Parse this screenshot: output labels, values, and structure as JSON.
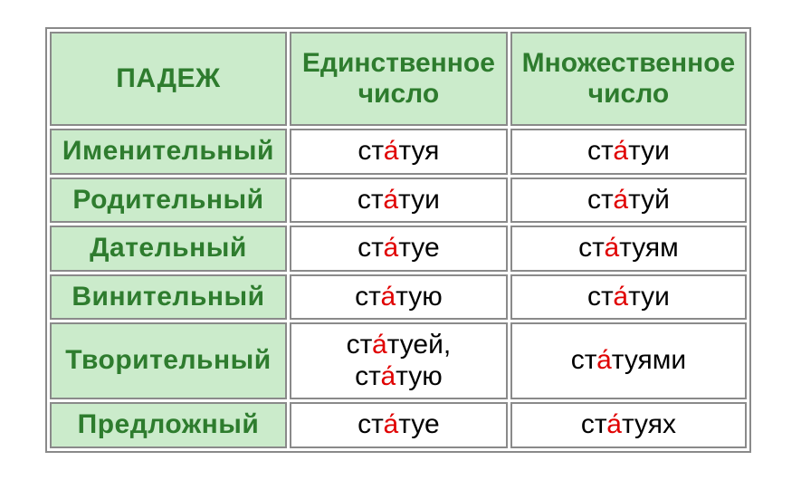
{
  "headers": {
    "case": "ПАДЕЖ",
    "singular_l1": "Единственное",
    "singular_l2": "число",
    "plural_l1": "Множественное",
    "plural_l2": "число"
  },
  "rows": [
    {
      "case": "Именительный",
      "sg": {
        "pre": "ст",
        "accent": "а́",
        "post": "туя"
      },
      "pl": {
        "pre": "ст",
        "accent": "а́",
        "post": "туи"
      }
    },
    {
      "case": "Родительный",
      "sg": {
        "pre": "ст",
        "accent": "а́",
        "post": "туи"
      },
      "pl": {
        "pre": "ст",
        "accent": "а́",
        "post": "туй"
      }
    },
    {
      "case": "Дательный",
      "sg": {
        "pre": "ст",
        "accent": "а́",
        "post": "туе"
      },
      "pl": {
        "pre": "ст",
        "accent": "а́",
        "post": "туям"
      }
    },
    {
      "case": "Винительный",
      "sg": {
        "pre": "ст",
        "accent": "а́",
        "post": "тую"
      },
      "pl": {
        "pre": "ст",
        "accent": "а́",
        "post": "туи"
      }
    },
    {
      "case": "Творительный",
      "sg": {
        "pre": "ст",
        "accent": "а́",
        "post": "туей,",
        "pre2": "ст",
        "accent2": "а́",
        "post2": "тую"
      },
      "pl": {
        "pre": "ст",
        "accent": "а́",
        "post": "туями"
      }
    },
    {
      "case": "Предложный",
      "sg": {
        "pre": "ст",
        "accent": "а́",
        "post": "туе"
      },
      "pl": {
        "pre": "ст",
        "accent": "а́",
        "post": "туях"
      }
    }
  ]
}
